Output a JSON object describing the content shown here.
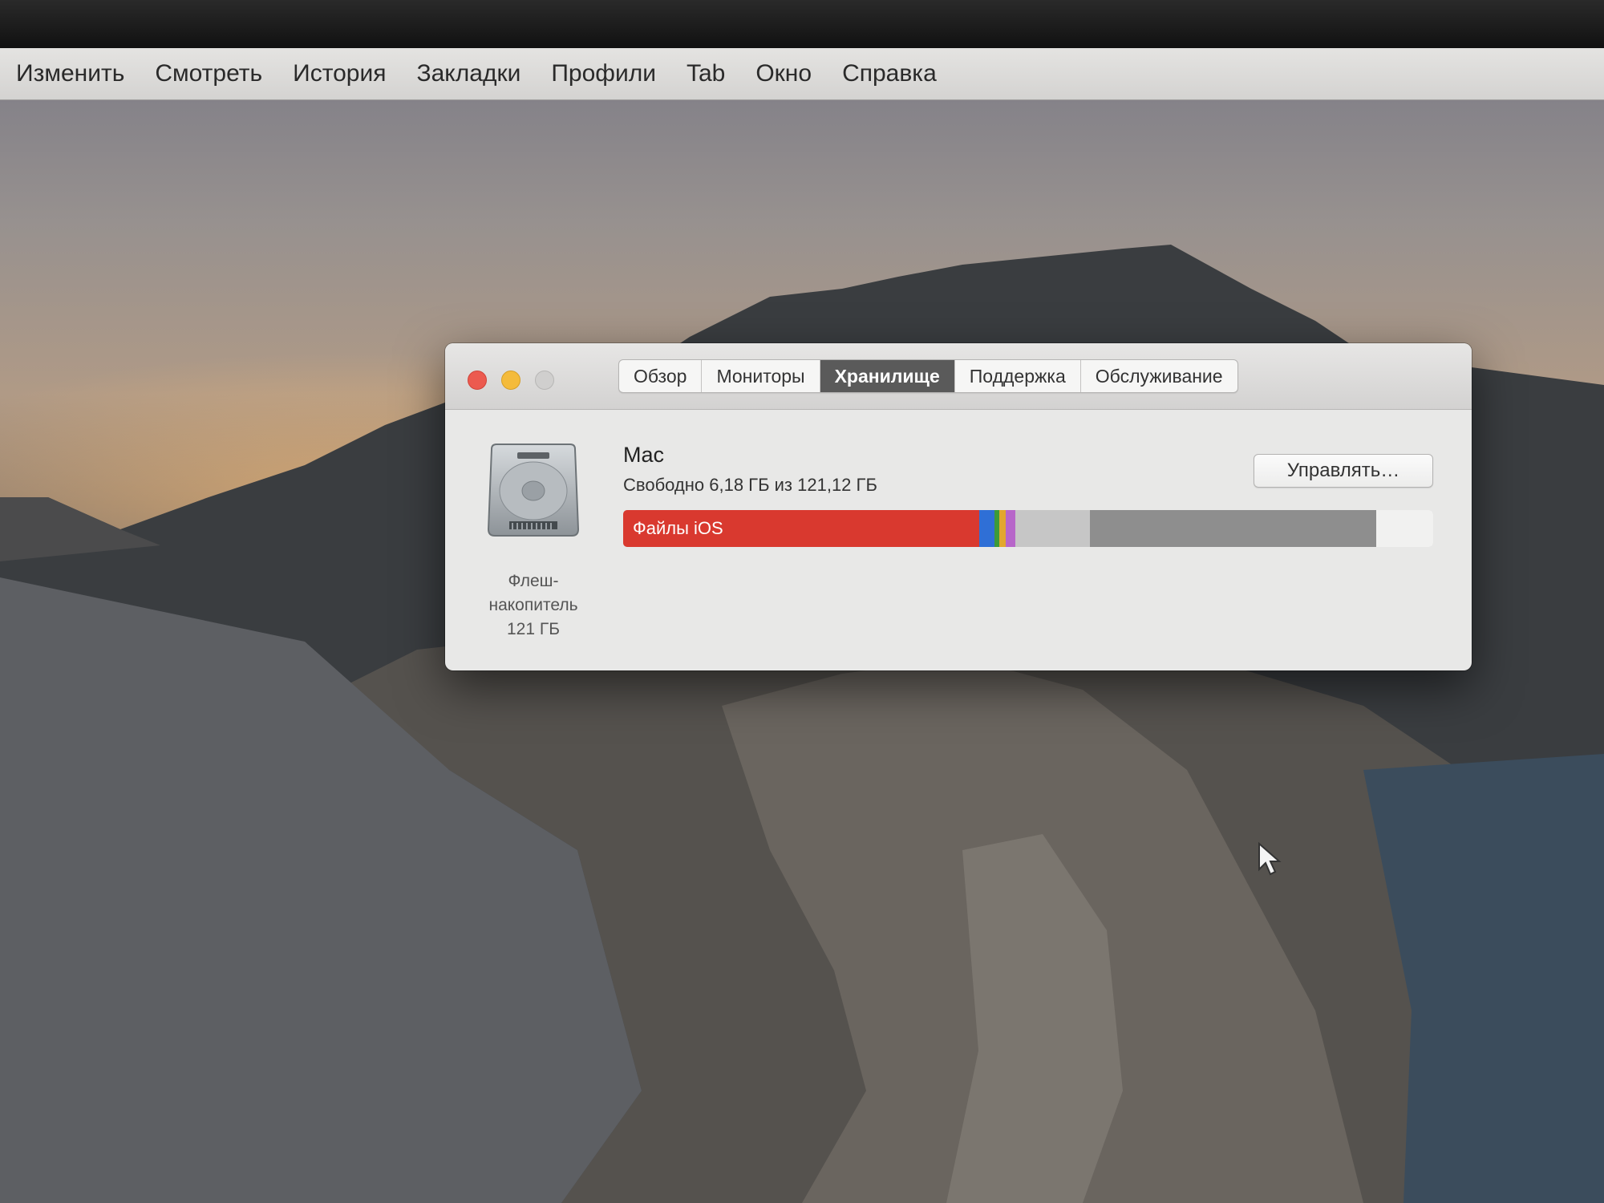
{
  "menubar": {
    "items": [
      "Изменить",
      "Смотреть",
      "История",
      "Закладки",
      "Профили",
      "Tab",
      "Окно",
      "Справка"
    ]
  },
  "window": {
    "tabs": [
      {
        "label": "Обзор",
        "active": false
      },
      {
        "label": "Мониторы",
        "active": false
      },
      {
        "label": "Хранилище",
        "active": true
      },
      {
        "label": "Поддержка",
        "active": false
      },
      {
        "label": "Обслуживание",
        "active": false
      }
    ],
    "drive": {
      "icon": "hard-drive-icon",
      "caption_lines": [
        "Флеш-",
        "накопитель",
        "121 ГБ"
      ]
    },
    "disk_name": "Mac",
    "free_text": "Свободно 6,18 ГБ из 121,12 ГБ",
    "manage_label": "Управлять…",
    "storage_bar": {
      "segments": [
        {
          "label": "Файлы iOS",
          "fraction": 0.44,
          "color": "#d9392f"
        },
        {
          "label": "",
          "fraction": 0.018,
          "color": "#2f6fd6"
        },
        {
          "label": "",
          "fraction": 0.006,
          "color": "#3c9a3a"
        },
        {
          "label": "",
          "fraction": 0.008,
          "color": "#e2a72e"
        },
        {
          "label": "",
          "fraction": 0.012,
          "color": "#b766c9"
        },
        {
          "label": "",
          "fraction": 0.092,
          "color": "#c6c6c6"
        },
        {
          "label": "",
          "fraction": 0.354,
          "color": "#8e8e8e"
        },
        {
          "label": "",
          "fraction": 0.07,
          "color": "#f1f1f0"
        }
      ]
    }
  },
  "colors": {
    "close": "#ec5a4f",
    "minimize": "#f4bb3b",
    "zoom": "#d0cfce",
    "active_tab": "#5a5a5a"
  }
}
